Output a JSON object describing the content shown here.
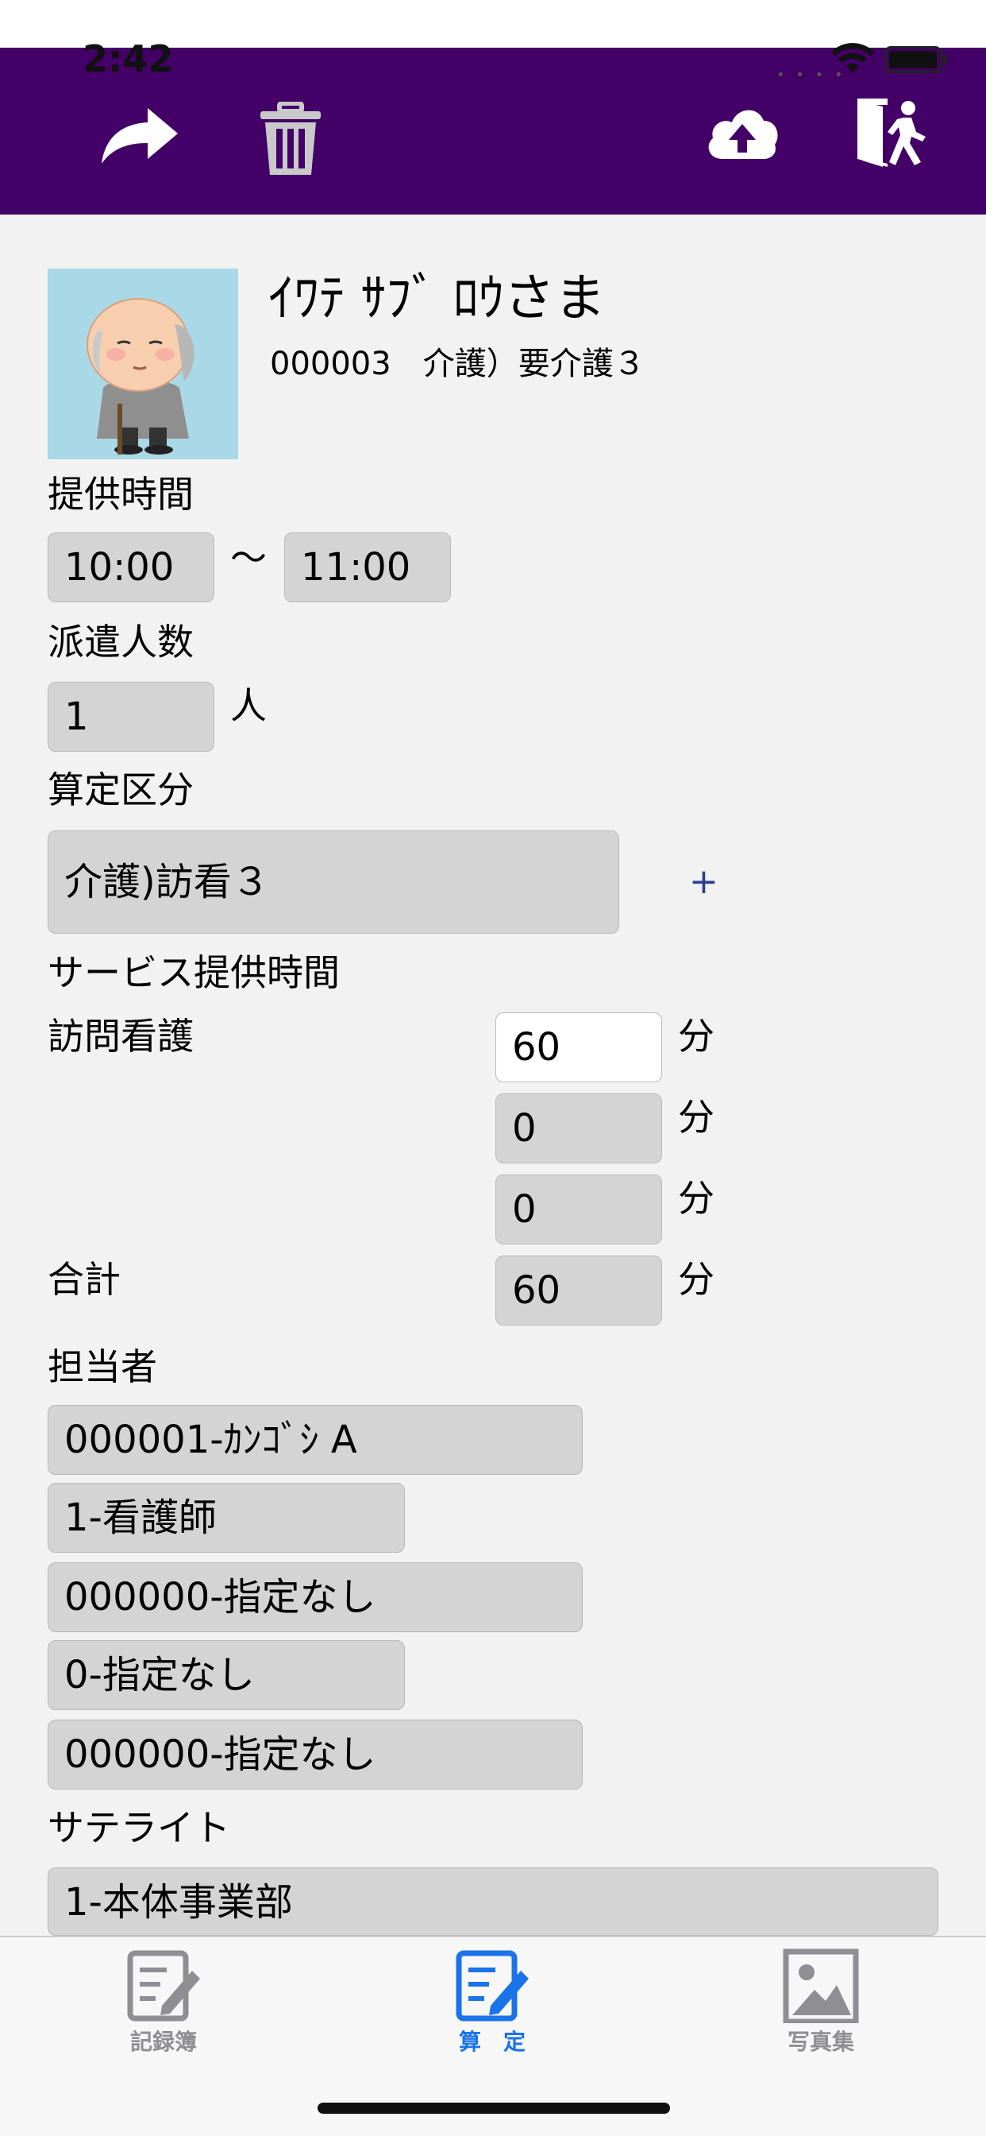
{
  "status": {
    "time": "2:42"
  },
  "navbar": {
    "icons": [
      "share-arrow-icon",
      "trash-icon",
      "cloud-upload-icon",
      "exit-door-icon"
    ],
    "color": "#430066"
  },
  "patient": {
    "name": "ｲﾜﾃ ｻﾌﾞ ﾛｳさま",
    "info": "000003　介護）要介護３"
  },
  "provision_time": {
    "label": "提供時間",
    "start": "10:00",
    "tilde": "〜",
    "end": "11:00"
  },
  "dispatch": {
    "label": "派遣人数",
    "value": "1",
    "unit": "人"
  },
  "calc_category": {
    "label": "算定区分",
    "value": "介護)訪看３",
    "add_label": "+"
  },
  "service_time": {
    "label": "サービス提供時間",
    "rows": [
      {
        "label": "訪問看護",
        "value": "60",
        "unit": "分"
      },
      {
        "label": "",
        "value": "0",
        "unit": "分"
      },
      {
        "label": "",
        "value": "0",
        "unit": "分"
      }
    ],
    "total_label": "合計",
    "total_value": "60",
    "total_unit": "分"
  },
  "staff": {
    "label": "担当者",
    "entries": [
      "000001-ｶﾝｺﾞｼ A",
      "1-看護師",
      "000000-指定なし",
      "0-指定なし",
      "000000-指定なし"
    ]
  },
  "satellite": {
    "label": "サテライト",
    "value": "1-本体事業部"
  },
  "tabbar": {
    "tabs": [
      {
        "label": "記録簿",
        "icon": "edit-note-icon",
        "color": "#8e8e93"
      },
      {
        "label": "算　定",
        "icon": "edit-note-icon",
        "color": "#1a73e8"
      },
      {
        "label": "写真集",
        "icon": "photo-icon",
        "color": "#8e8e93"
      }
    ]
  }
}
